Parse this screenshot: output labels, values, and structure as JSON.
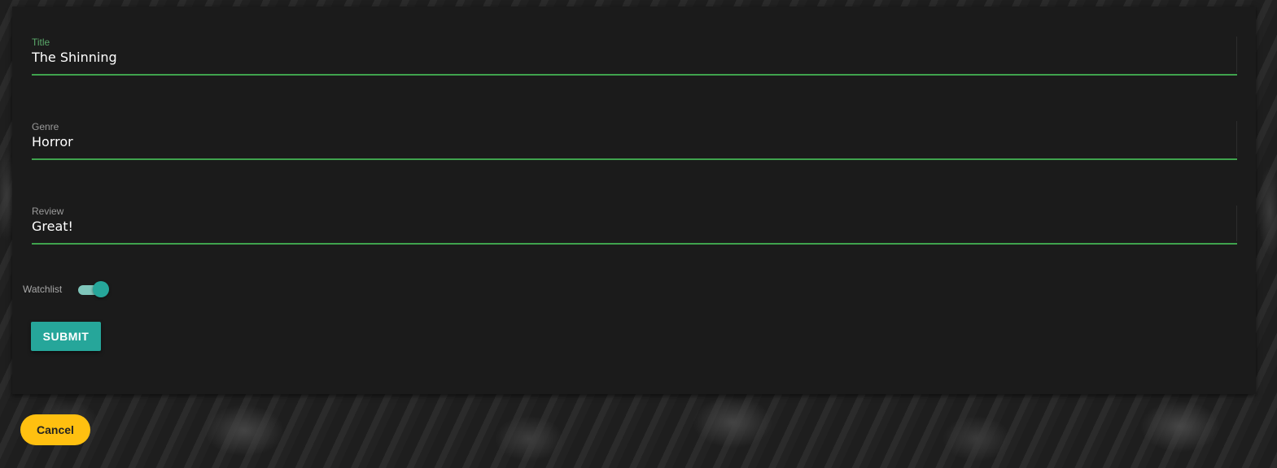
{
  "form": {
    "title": {
      "label": "Title",
      "value": "The Shinning"
    },
    "genre": {
      "label": "Genre",
      "value": "Horror"
    },
    "review": {
      "label": "Review",
      "value": "Great!"
    },
    "watchlist": {
      "label": "Watchlist",
      "checked": true
    },
    "submit_label": "SUBMIT"
  },
  "cancel_label": "Cancel",
  "colors": {
    "accent_teal": "#26a69a",
    "underline_green": "#3fa34d",
    "cancel_yellow": "#ffc010",
    "panel_bg": "#1b1b1b"
  }
}
